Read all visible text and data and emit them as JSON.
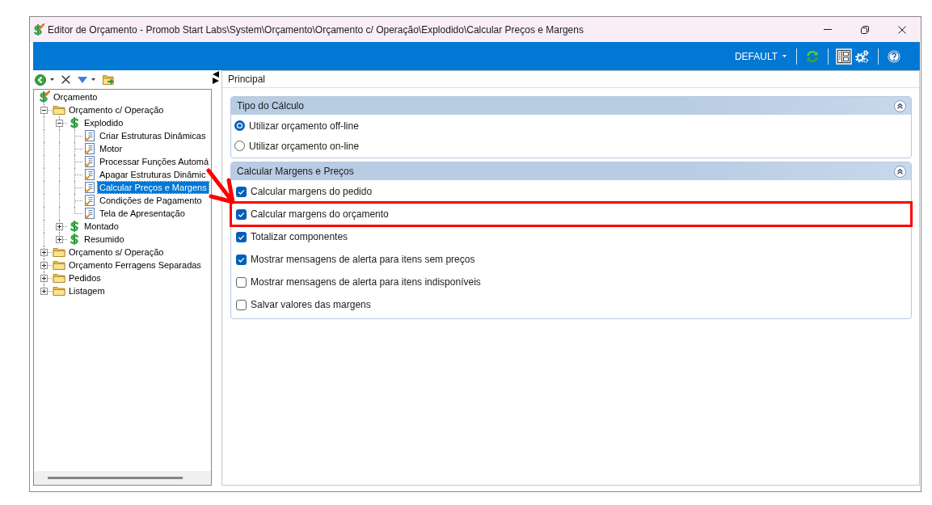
{
  "window": {
    "title": "Editor de Orçamento - Promob Start Labs\\System\\Orçamento\\Orçamento c/ Operação\\Explodido\\Calcular Preços e Margens"
  },
  "toolbar": {
    "profile": "DEFAULT",
    "button_groups": [
      [
        {
          "kind": "refresh",
          "pressed": false
        }
      ],
      [
        {
          "kind": "layout",
          "pressed": true
        },
        {
          "kind": "settings",
          "pressed": false
        }
      ],
      [
        {
          "kind": "help",
          "pressed": false
        }
      ]
    ]
  },
  "tree_toolbar": [
    {
      "kind": "back",
      "dropdown": true
    },
    {
      "kind": "delete",
      "dropdown": false
    },
    {
      "kind": "move_down",
      "dropdown": true
    },
    {
      "kind": "open_folder",
      "dropdown": false
    }
  ],
  "tree": [
    {
      "label": "Orçamento",
      "kind": "budget_root",
      "selected": false,
      "children": [
        {
          "label": "Orçamento c/ Operação",
          "kind": "folder",
          "expanded": true,
          "selected": false,
          "children": [
            {
              "label": "Explodido",
              "kind": "budget",
              "expanded": true,
              "selected": false,
              "children": [
                {
                  "label": "Criar Estruturas Dinâmicas",
                  "kind": "task",
                  "selected": false
                },
                {
                  "label": "Motor",
                  "kind": "task",
                  "selected": false
                },
                {
                  "label": "Processar Funções Automá",
                  "kind": "task",
                  "selected": false
                },
                {
                  "label": "Apagar Estruturas Dinâmic",
                  "kind": "task",
                  "selected": false
                },
                {
                  "label": "Calcular Preços e Margens",
                  "kind": "task",
                  "selected": true
                },
                {
                  "label": "Condições de Pagamento",
                  "kind": "task",
                  "selected": false
                },
                {
                  "label": "Tela de Apresentação",
                  "kind": "task",
                  "selected": false
                }
              ]
            },
            {
              "label": "Montado",
              "kind": "budget",
              "expanded": false,
              "selected": false
            },
            {
              "label": "Resumido",
              "kind": "budget",
              "expanded": false,
              "selected": false
            }
          ]
        },
        {
          "label": "Orçamento s/ Operação",
          "kind": "folder",
          "expanded": false,
          "selected": false
        },
        {
          "label": "Orçamento Ferragens Separadas",
          "kind": "folder",
          "expanded": false,
          "selected": false
        },
        {
          "label": "Pedidos",
          "kind": "folder",
          "expanded": false,
          "selected": false
        },
        {
          "label": "Listagem",
          "kind": "folder",
          "expanded": false,
          "selected": false
        }
      ]
    }
  ],
  "panel": {
    "title": "Principal",
    "sections": [
      {
        "title": "Tipo do Cálculo",
        "kind": "radio",
        "expanded": true,
        "options": [
          {
            "label": "Utilizar orçamento off-line",
            "selected": true
          },
          {
            "label": "Utilizar orçamento on-line",
            "selected": false
          }
        ]
      },
      {
        "title": "Calcular Margens e Preços",
        "kind": "checkbox",
        "expanded": true,
        "options": [
          {
            "label": "Calcular margens do pedido",
            "checked": true,
            "highlighted": false
          },
          {
            "label": "Calcular margens do orçamento",
            "checked": true,
            "highlighted": true
          },
          {
            "label": "Totalizar componentes",
            "checked": true,
            "highlighted": false
          },
          {
            "label": "Mostrar mensagens de alerta para itens sem preços",
            "checked": true,
            "highlighted": false
          },
          {
            "label": "Mostrar mensagens de alerta para itens indisponíveis",
            "checked": false,
            "highlighted": false
          },
          {
            "label": "Salvar valores das margens",
            "checked": false,
            "highlighted": false
          }
        ]
      }
    ]
  }
}
